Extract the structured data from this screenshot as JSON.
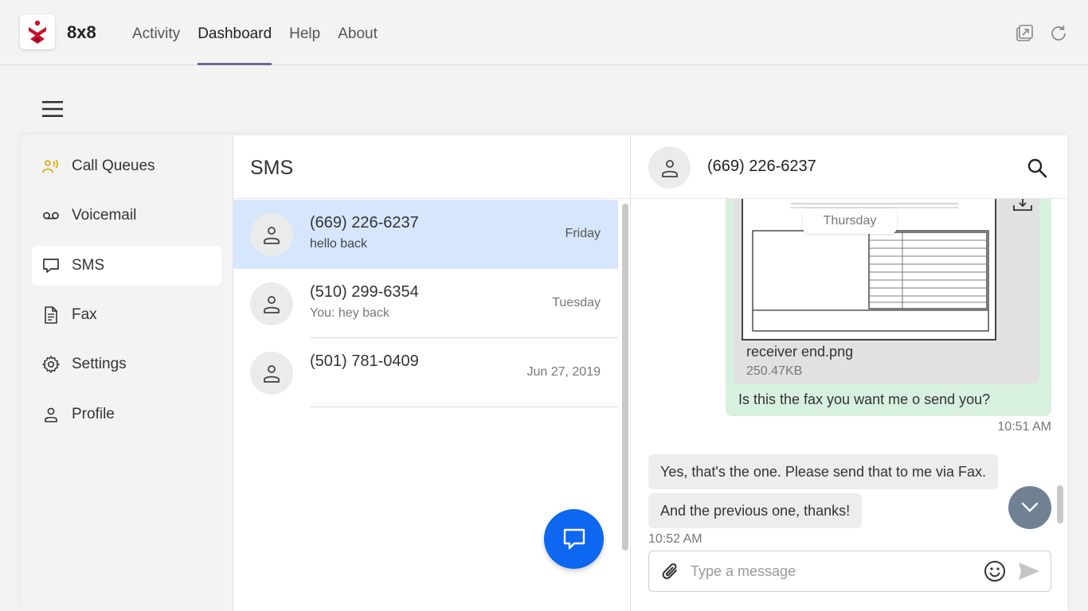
{
  "app": {
    "name": "8x8"
  },
  "nav": {
    "tabs": [
      {
        "label": "Activity",
        "active": false
      },
      {
        "label": "Dashboard",
        "active": true
      },
      {
        "label": "Help",
        "active": false
      },
      {
        "label": "About",
        "active": false
      }
    ],
    "icons": [
      "open-external-icon",
      "refresh-icon"
    ]
  },
  "sidebar": {
    "items": [
      {
        "label": "Call Queues",
        "icon": "call-queues-icon",
        "active": false
      },
      {
        "label": "Voicemail",
        "icon": "voicemail-icon",
        "active": false
      },
      {
        "label": "SMS",
        "icon": "sms-icon",
        "active": true
      },
      {
        "label": "Fax",
        "icon": "fax-icon",
        "active": false
      },
      {
        "label": "Settings",
        "icon": "gear-icon",
        "active": false
      },
      {
        "label": "Profile",
        "icon": "profile-icon",
        "active": false
      }
    ]
  },
  "sms_list": {
    "title": "SMS",
    "conversations": [
      {
        "number": "(669) 226-6237",
        "preview": "hello back",
        "when": "Friday",
        "selected": true
      },
      {
        "number": "(510) 299-6354",
        "preview": "You: hey back",
        "when": "Tuesday",
        "selected": false
      },
      {
        "number": "(501) 781-0409",
        "preview": "",
        "when": "Jun 27, 2019",
        "selected": false
      }
    ]
  },
  "conversation": {
    "number": "(669) 226-6237",
    "day_separator": "Thursday",
    "attachment": {
      "name": "receiver end.png",
      "size": "250.47KB"
    },
    "outgoing_text": "Is this the fax you want me o send you?",
    "outgoing_time": "10:51 AM",
    "incoming": [
      "Yes, that's the one. Please send that to me via Fax.",
      "And the previous one, thanks!"
    ],
    "incoming_time": "10:52 AM",
    "composer": {
      "placeholder": "Type a message",
      "value": ""
    }
  },
  "colors": {
    "accent": "#6b6a9a",
    "selected_row": "#d6e6fd",
    "fab": "#0d67f0",
    "outgoing_bubble": "#d7f1de",
    "incoming_bubble": "#ededed",
    "logo_red": "#c8102e"
  }
}
